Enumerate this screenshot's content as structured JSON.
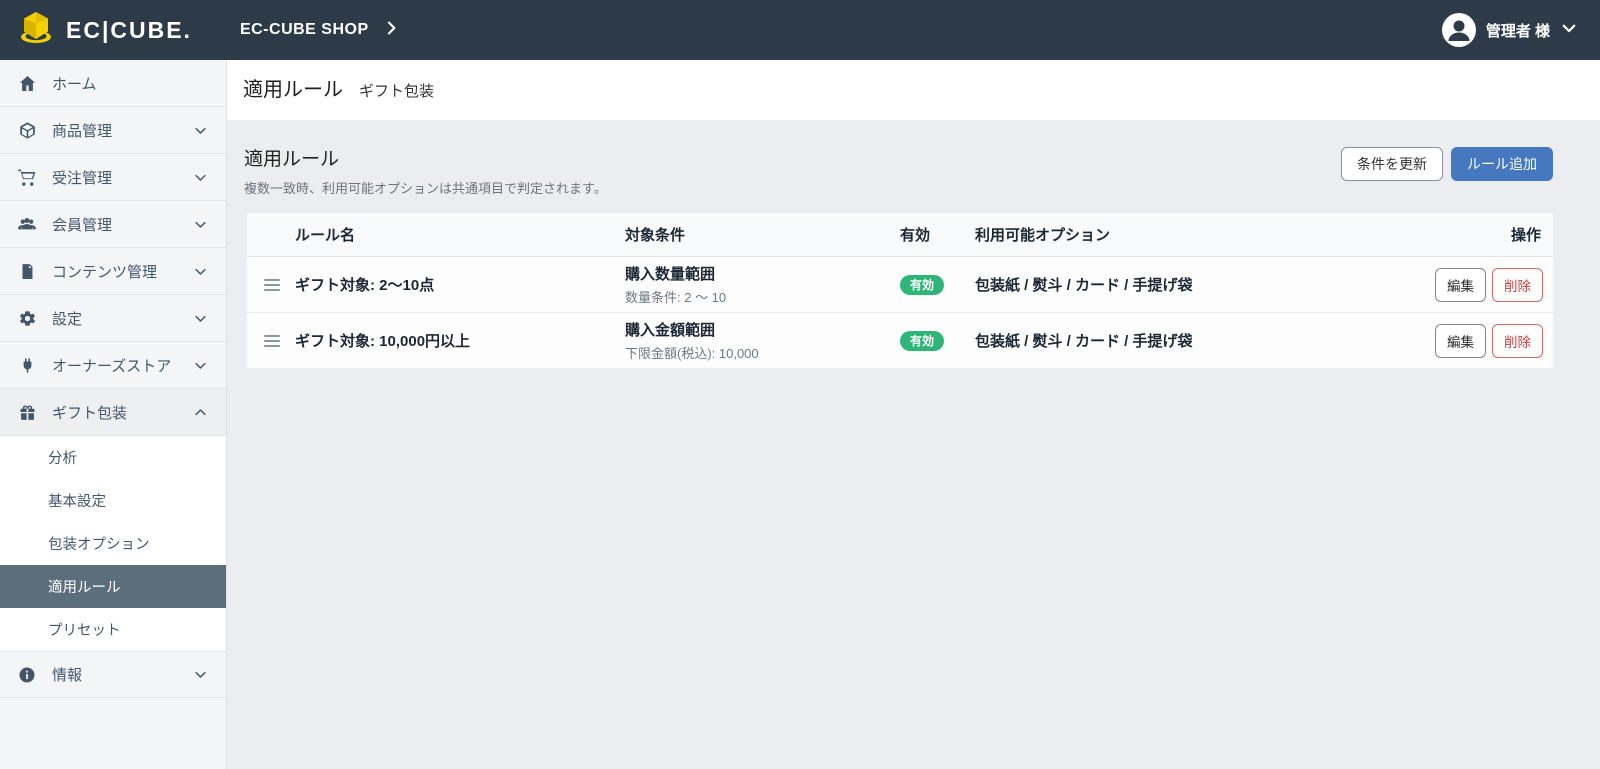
{
  "header": {
    "logo_text": "EC|CUBE.",
    "shop_name": "EC-CUBE SHOP",
    "user_name": "管理者 様"
  },
  "sidebar": {
    "items": [
      {
        "label": "ホーム",
        "icon": "home-icon",
        "chevron": null
      },
      {
        "label": "商品管理",
        "icon": "box-icon",
        "chevron": "down"
      },
      {
        "label": "受注管理",
        "icon": "cart-icon",
        "chevron": "down"
      },
      {
        "label": "会員管理",
        "icon": "users-icon",
        "chevron": "down"
      },
      {
        "label": "コンテンツ管理",
        "icon": "document-icon",
        "chevron": "down"
      },
      {
        "label": "設定",
        "icon": "gear-icon",
        "chevron": "down"
      },
      {
        "label": "オーナーズストア",
        "icon": "plug-icon",
        "chevron": "down"
      },
      {
        "label": "ギフト包装",
        "icon": "gift-icon",
        "chevron": "up"
      }
    ],
    "submenu": [
      {
        "label": "分析",
        "active": false
      },
      {
        "label": "基本設定",
        "active": false
      },
      {
        "label": "包装オプション",
        "active": false
      },
      {
        "label": "適用ルール",
        "active": true
      },
      {
        "label": "プリセット",
        "active": false
      }
    ],
    "info_item": {
      "label": "情報",
      "icon": "info-icon",
      "chevron": "down"
    }
  },
  "page": {
    "title": "適用ルール",
    "subtitle": "ギフト包装"
  },
  "section": {
    "title": "適用ルール",
    "description": "複数一致時、利用可能オプションは共通項目で判定されます。",
    "update_button": "条件を更新",
    "add_button": "ルール追加"
  },
  "table": {
    "headers": {
      "name": "ルール名",
      "condition": "対象条件",
      "enabled": "有効",
      "options": "利用可能オプション",
      "actions": "操作"
    },
    "rows": [
      {
        "name": "ギフト対象: 2〜10点",
        "condition_title": "購入数量範囲",
        "condition_detail": "数量条件: 2 〜 10",
        "status": "有効",
        "options": "包装紙 / 熨斗 / カード / 手提げ袋",
        "edit_label": "編集",
        "delete_label": "削除"
      },
      {
        "name": "ギフト対象: 10,000円以上",
        "condition_title": "購入金額範囲",
        "condition_detail": "下限金額(税込): 10,000",
        "status": "有効",
        "options": "包装紙 / 熨斗 / カード / 手提げ袋",
        "edit_label": "編集",
        "delete_label": "削除"
      }
    ]
  },
  "colors": {
    "header_bg": "#2d3a48",
    "accent_blue": "#4678c0",
    "status_green": "#2fb578",
    "danger_red": "#c9433e",
    "logo_yellow": "#f5d000"
  }
}
